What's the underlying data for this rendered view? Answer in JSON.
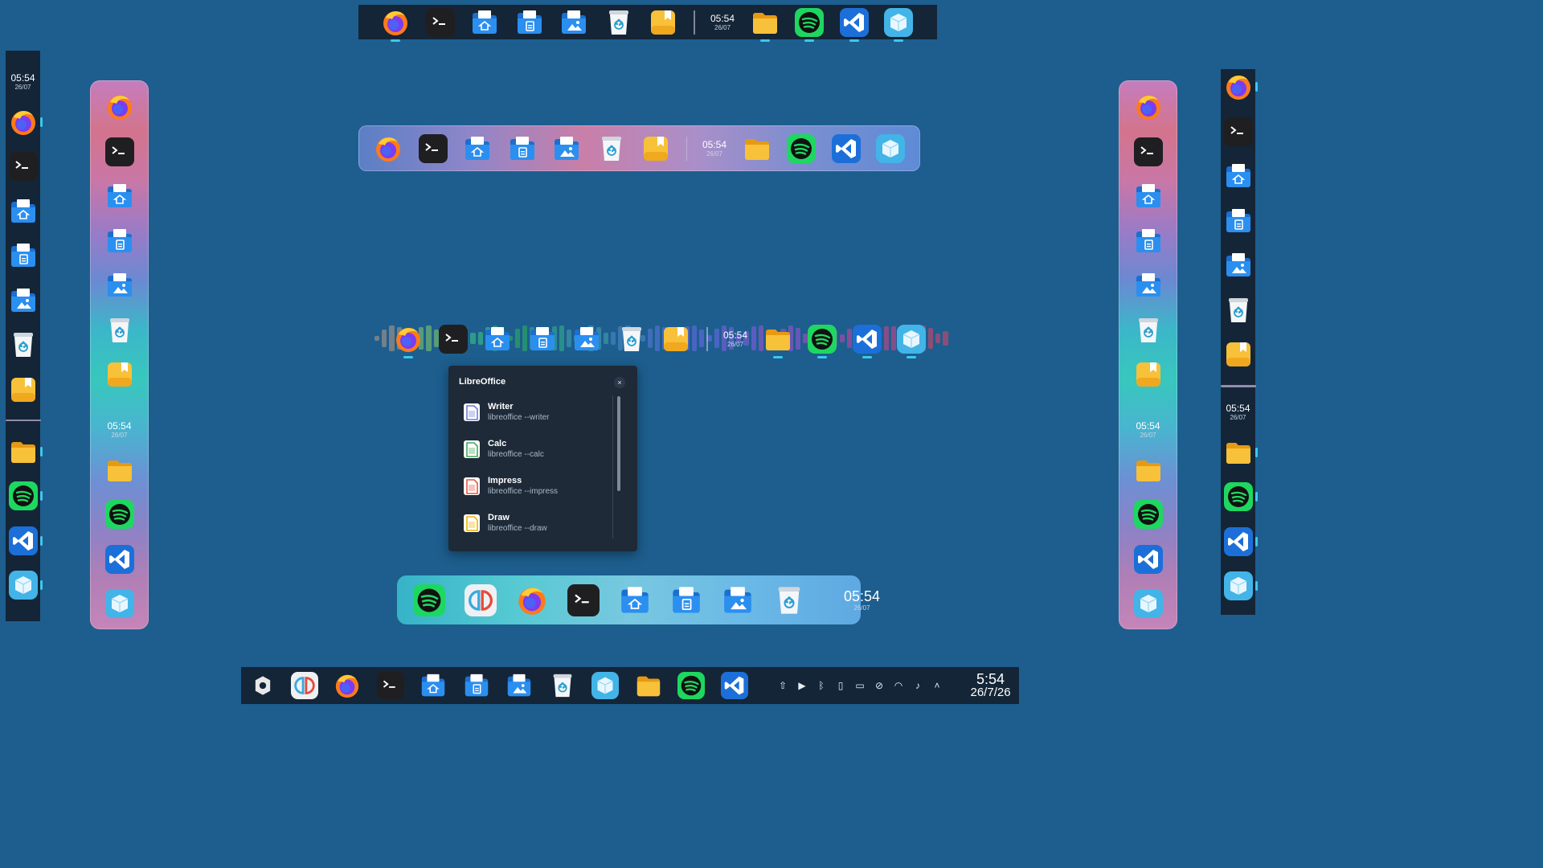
{
  "clock": {
    "time": "05:54",
    "date": "26/07"
  },
  "bottom_clock": {
    "time": "5:54",
    "date": "26/7/26"
  },
  "popup": {
    "title": "LibreOffice",
    "close_glyph": "×",
    "items": [
      {
        "name": "Writer",
        "command": "libreoffice --writer",
        "color": "#6c7bd8"
      },
      {
        "name": "Calc",
        "command": "libreoffice --calc",
        "color": "#3faa5a"
      },
      {
        "name": "Impress",
        "command": "libreoffice --impress",
        "color": "#e05a4a"
      },
      {
        "name": "Draw",
        "command": "libreoffice --draw",
        "color": "#f0b400"
      }
    ]
  },
  "docks": {
    "main_apps": [
      "firefox-icon",
      "terminal-icon",
      "home-folder-icon",
      "documents-folder-icon",
      "pictures-folder-icon",
      "trash-icon",
      "notes-icon"
    ],
    "pinned_apps": [
      "files-icon",
      "spotify-icon",
      "vscode-icon",
      "package-icon"
    ],
    "bottom_apps": [
      "spotify-icon",
      "yuzu-icon",
      "firefox-icon",
      "terminal-icon",
      "home-folder-icon",
      "documents-folder-icon",
      "pictures-folder-icon",
      "trash-icon"
    ],
    "taskbar_apps": [
      "yuzu-icon",
      "firefox-icon",
      "terminal-icon",
      "home-folder-icon",
      "documents-folder-icon",
      "pictures-folder-icon",
      "trash-icon",
      "package-icon",
      "files-icon",
      "spotify-icon",
      "vscode-icon"
    ],
    "tray": [
      "update-icon",
      "media-play-icon",
      "bluetooth-icon",
      "mouse-icon",
      "battery-icon",
      "touchpad-off-icon",
      "wifi-icon",
      "volume-icon",
      "chevron-up-icon"
    ]
  },
  "colors": {
    "background": "#1d5e8e",
    "panel_dark": "#142537",
    "indicator": "#3cc8f0",
    "folder_blue": "#2b8ff0",
    "folder_yellow": "#f8c13a",
    "spotify_green": "#1ed760",
    "vscode_blue": "#1c6fd8"
  }
}
